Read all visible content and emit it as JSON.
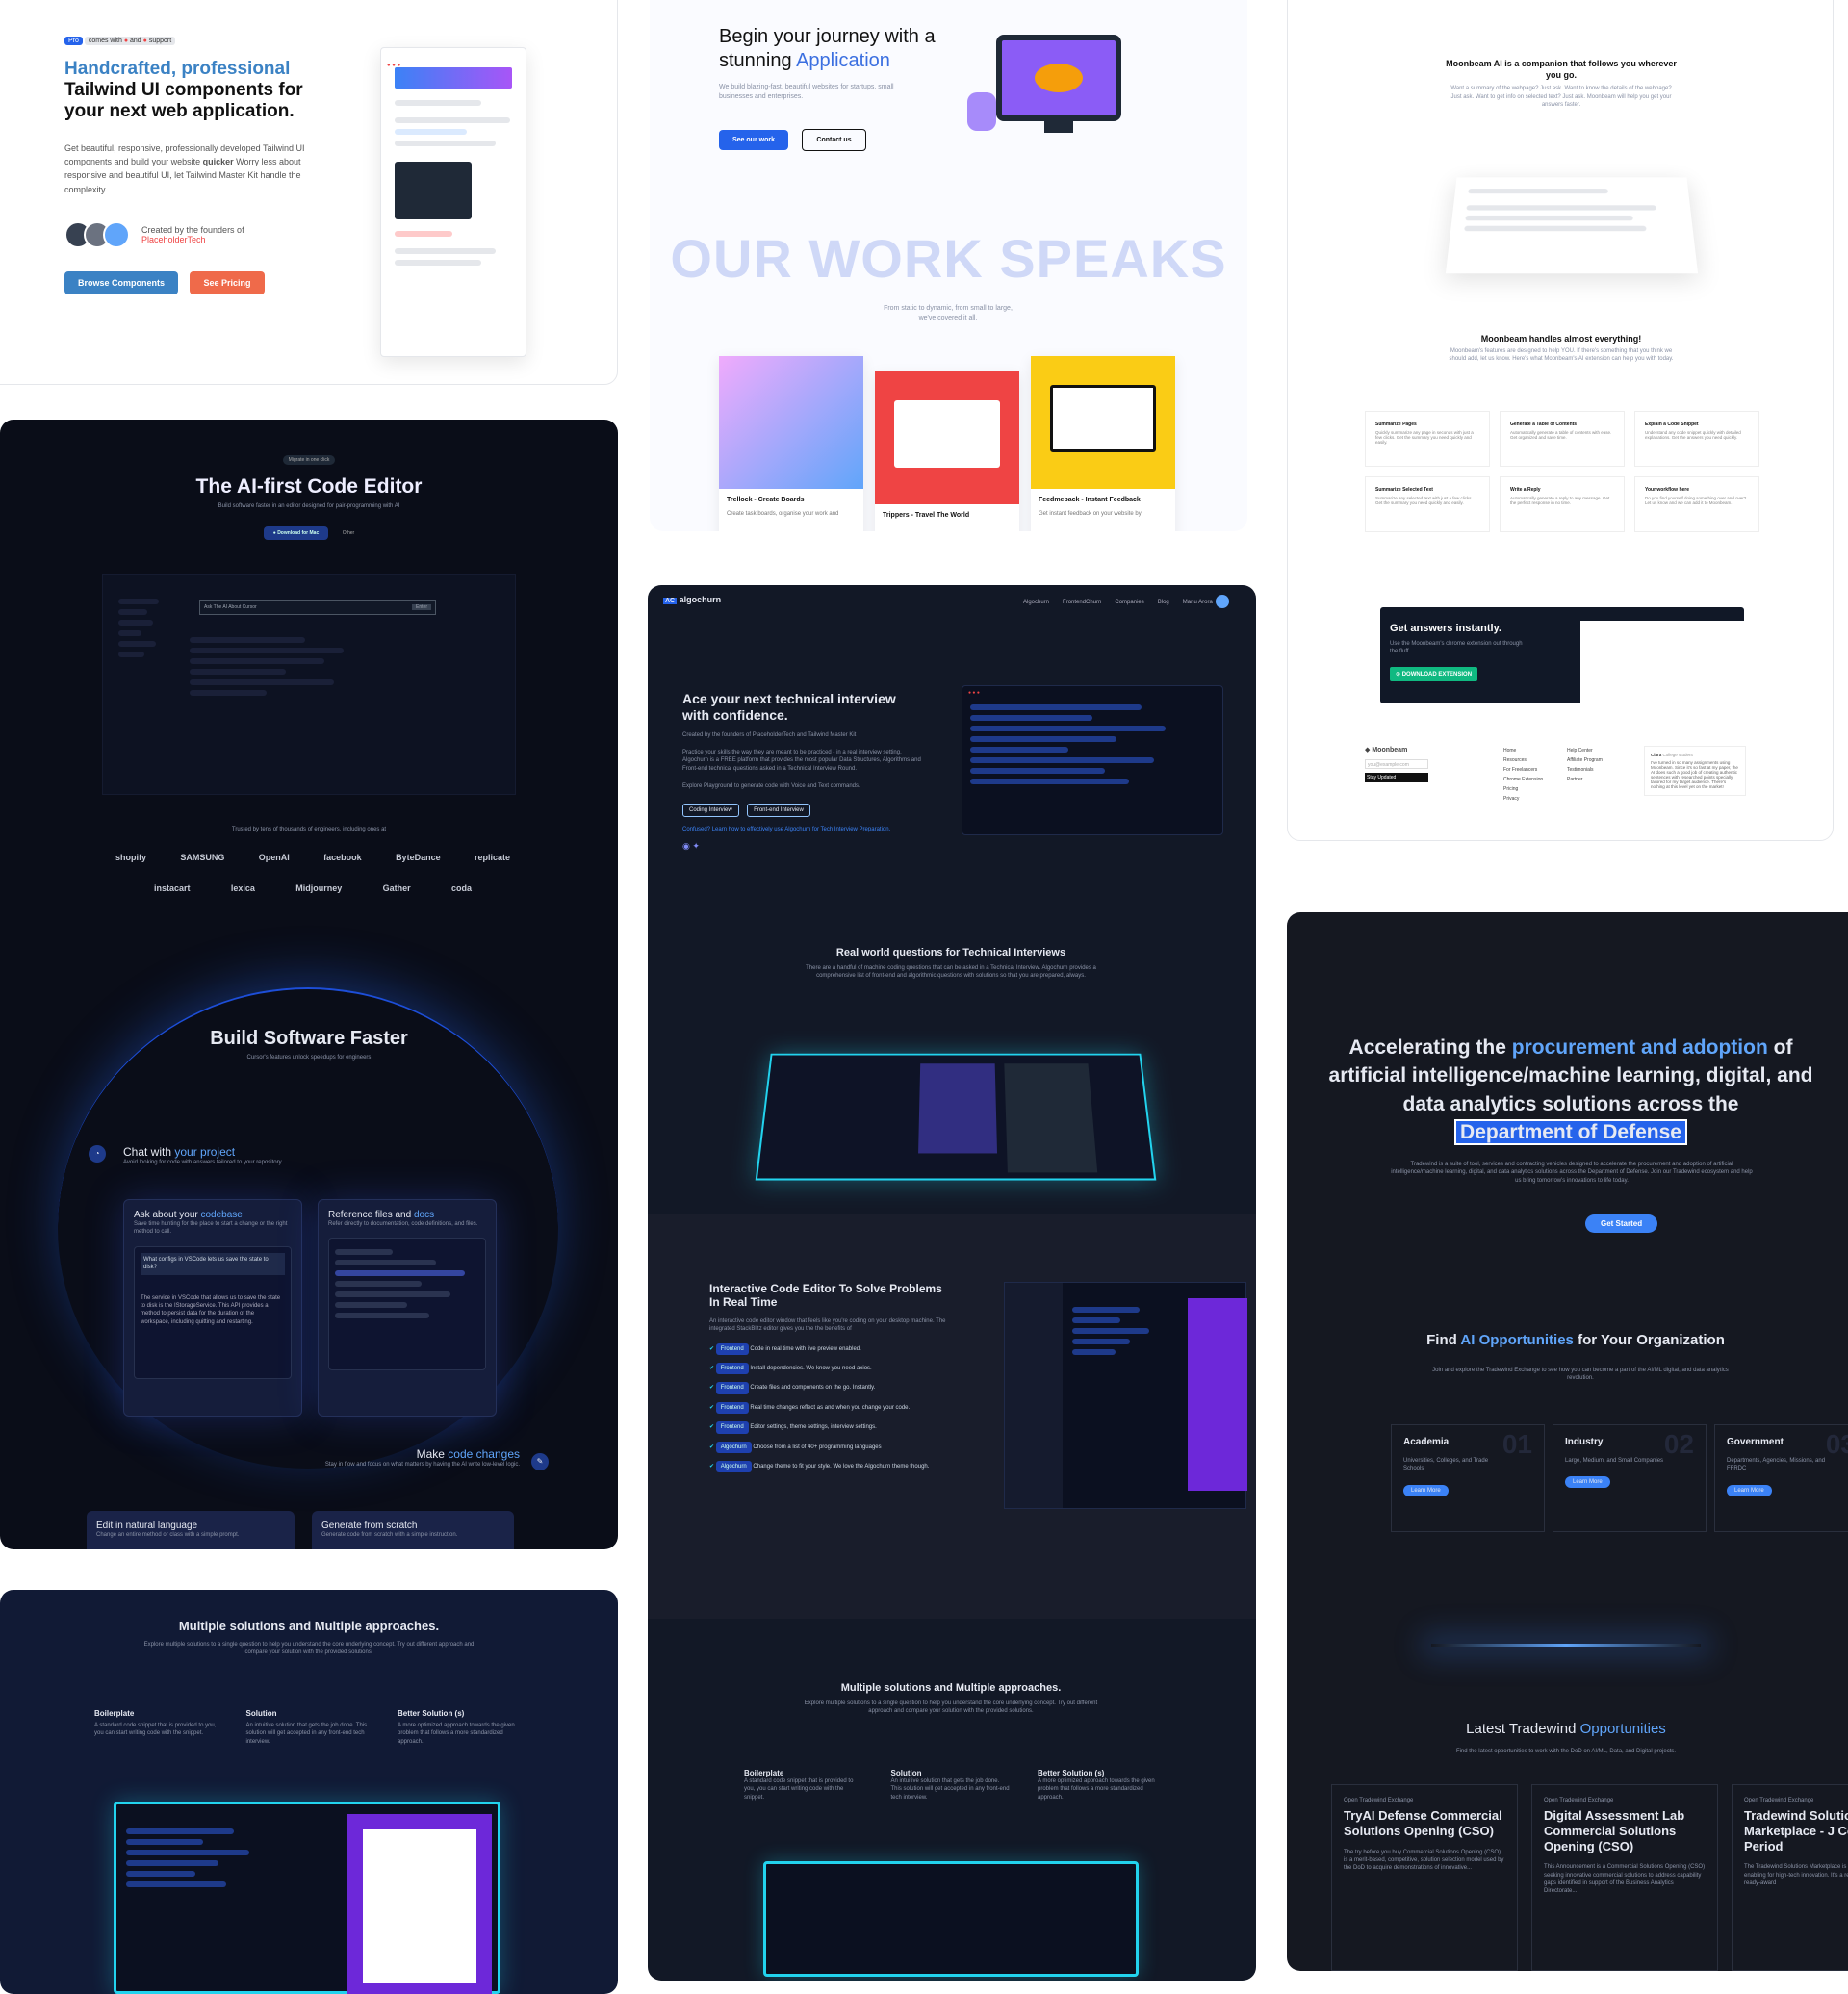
{
  "c1": {
    "badge_pro": "Pro",
    "badge_comes": "comes with",
    "badge_and": "and",
    "badge_support": "support",
    "title_hl": "Handcrafted, professional",
    "title_rest": "Tailwind UI components for your next web application.",
    "desc1": "Get beautiful, responsive, professionally developed Tailwind UI components and build your website",
    "desc_bold": "quicker",
    "desc2": "Worry less about responsive and beautiful UI, let Tailwind Master Kit handle the complexity.",
    "created_by": "Created by the founders of",
    "created_link": "PlaceholderTech",
    "btn_browse": "Browse Components",
    "btn_pricing": "See Pricing"
  },
  "c2": {
    "title_a": "Begin your journey with a",
    "title_b": "stunning",
    "title_hl": "Application",
    "desc": "We build blazing-fast, beautiful websites for startups, small businesses and enterprises.",
    "btn_work": "See our work",
    "btn_contact": "Contact us",
    "big": "OUR WORK SPEAKS",
    "sub": "From static to dynamic, from small to large, we've covered it all.",
    "projects": [
      {
        "title": "Trellock - Create Boards",
        "desc": "Create task boards, organise your work and"
      },
      {
        "title": "Trippers - Travel The World",
        "desc": ""
      },
      {
        "title": "Feedmeback - Instant Feedback",
        "desc": "Get instant feedback on your website by"
      }
    ]
  },
  "c3": {
    "intro_title": "Moonbeam AI is a companion that follows you wherever you go.",
    "intro_desc": "Want a summary of the webpage? Just ask. Want to know the details of the webpage? Just ask. Want to get info on selected text? Just ask. Moonbeam will help you get your answers faster.",
    "handles_title": "Moonbeam handles almost everything!",
    "handles_desc": "Moonbeam's features are designed to help YOU. If there's something that you think we should add, let us know. Here's what Moonbeam's AI extension can help you with today.",
    "features": [
      {
        "t": "Summarize Pages",
        "d": "Quickly summarize any page in seconds with just a few clicks. Get the summary you need quickly and easily."
      },
      {
        "t": "Generate a Table of Contents",
        "d": "Automatically generate a table of contents with ease. Get organized and save time."
      },
      {
        "t": "Explain a Code Snippet",
        "d": "Understand any code snippet quickly with detailed explanations. Get the answers you need quickly."
      },
      {
        "t": "Summarize Selected Text",
        "d": "Summarize any selected text with just a few clicks. Get the summary you need quickly and easily."
      },
      {
        "t": "Write a Reply",
        "d": "Automatically generate a reply to any message. Get the perfect response in no time."
      },
      {
        "t": "Your workflow here",
        "d": "Do you find yourself doing something over and over? Let us know and we can add it to Moonbeam."
      }
    ],
    "cta_title": "Get answers instantly.",
    "cta_desc": "Use the Moonbeam's chrome extension out through the fluff.",
    "cta_btn": "DOWNLOAD EXTENSION",
    "footer_brand": "Moonbeam",
    "footer_input": "you@example.com",
    "footer_btn": "Stay Updated",
    "footer_col1": [
      "Home",
      "Resources",
      "For Freelancers",
      "Chrome Extension",
      "Pricing",
      "Privacy"
    ],
    "footer_col2": [
      "Help Center",
      "Affiliate Program",
      "Testimonials",
      "Partner"
    ],
    "testimonial_name": "Clara",
    "testimonial_role": "College student",
    "testimonial": "I've turned in so many assignments using Moonbeam. Since it's so fast at my paper, the AI does such a good job of creating authentic sentences with researched points specially tailored for my target audience. There's nothing at this level yet on the market!"
  },
  "c4": {
    "badge": "Migrate in one click",
    "title": "The AI-first Code Editor",
    "sub": "Build software faster in an editor designed for pair-programming with AI",
    "btn_download": "Download for Mac",
    "btn_other": "Other",
    "ask_placeholder": "Ask The AI About Cursor",
    "ask_btn": "Enter",
    "trusted": "Trusted by tens of thousands of engineers, including ones at",
    "logos": [
      "shopify",
      "SAMSUNG",
      "OpenAI",
      "facebook",
      "ByteDance",
      "replicate",
      "instacart",
      "lexica",
      "Midjourney",
      "Gather",
      "coda"
    ],
    "build_title": "Build Software Faster",
    "build_sub": "Cursor's features unlock speedups for engineers",
    "chat_title": "Chat with",
    "chat_hl": "your project",
    "chat_desc": "Avoid looking for code with answers tailored to your repository.",
    "panel1_title": "Ask about your",
    "panel1_hl": "codebase",
    "panel1_desc": "Save time hunting for the place to start a change or the right method to call.",
    "panel1_q": "What configs in VSCode lets us save the state to disk?",
    "panel1_a": "The service in VSCode that allows us to save the state to disk is the IStorageService. This API provides a method to persist data for the duration of the workspace, including quitting and restarting.",
    "panel2_title": "Reference files and",
    "panel2_hl": "docs",
    "panel2_desc": "Refer directly to documentation, code definitions, and files.",
    "make_title": "Make",
    "make_hl": "code changes",
    "make_desc": "Stay in flow and focus on what matters by having the AI write low-level logic.",
    "edit_title": "Edit in natural language",
    "edit_desc": "Change an entire method or class with a simple prompt.",
    "gen_title": "Generate from scratch",
    "gen_desc": "Generate code from scratch with a simple instruction."
  },
  "c5": {
    "brand": "algochurn",
    "nav": [
      "Algochurn",
      "FrontendChurn",
      "Companies",
      "Blog",
      "Manu Arora"
    ],
    "hero_title": "Ace your next technical interview with confidence.",
    "hero_created": "Created by the founders of PlaceholderTech and Tailwind Master Kit",
    "hero_desc": "Practice your skills the way they are meant to be practiced - in a real interview setting. Algochurn is a FREE platform that provides the most popular Data Structures, Algorithms and Front-end technical questions asked in a Technical Interview Round.",
    "hero_explore": "Explore Playground to generate code with Voice and Text commands.",
    "btn_coding": "Coding Interview",
    "btn_frontend": "Front-end Interview",
    "confused": "Confused? Learn how to effectively use Algochurn for Tech Interview Preparation.",
    "real_title": "Real world questions for Technical Interviews",
    "real_desc": "There are a handful of machine coding questions that can be asked in a Technical Interview. Algochurn provides a comprehensive list of front-end and algorithmic questions with solutions so that you are prepared, always.",
    "editor_title": "Interactive Code Editor To Solve Problems In Real Time",
    "editor_desc": "An interactive code editor window that feels like you're coding on your desktop machine. The integrated StackBlitz editor gives you the the benefits of",
    "features": [
      {
        "tag": "Frontend",
        "text": "Code in real time with live preview enabled."
      },
      {
        "tag": "Frontend",
        "text": "Install dependencies. We know you need axios."
      },
      {
        "tag": "Frontend",
        "text": "Create files and components on the go. Instantly."
      },
      {
        "tag": "Frontend",
        "text": "Real time changes reflect as and when you change your code."
      },
      {
        "tag": "Frontend",
        "text": "Editor settings, theme settings, interview settings."
      },
      {
        "tag": "Algochurn",
        "text": "Choose from a list of 40+ programming languages"
      },
      {
        "tag": "Algochurn",
        "text": "Change theme to fit your style. We love the Algochurn theme though."
      }
    ],
    "multi_title": "Multiple solutions and Multiple approaches.",
    "multi_desc": "Explore multiple solutions to a single question to help you understand the core underlying concept. Try out different approach and compare your solution with the provided solutions.",
    "cols": [
      {
        "t": "Boilerplate",
        "d": "A standard code snippet that is provided to you, you can start writing code with the snippet."
      },
      {
        "t": "Solution",
        "d": "An intuitive solution that gets the job done. This solution will get accepted in any front-end tech interview."
      },
      {
        "t": "Better Solution (s)",
        "d": "A more optimized approach towards the given problem that follows a more standardized approach."
      }
    ]
  },
  "c6": {
    "title": "Multiple solutions and Multiple approaches.",
    "desc": "Explore multiple solutions to a single question to help you understand the core underlying concept. Try out different approach and compare your solution with the provided solutions.",
    "cols": [
      {
        "t": "Boilerplate",
        "d": "A standard code snippet that is provided to you, you can start writing code with the snippet."
      },
      {
        "t": "Solution",
        "d": "An intuitive solution that gets the job done. This solution will get accepted in any front-end tech interview."
      },
      {
        "t": "Better Solution (s)",
        "d": "A more optimized approach towards the given problem that follows a more standardized approach."
      }
    ]
  },
  "c7": {
    "hero_a": "Accelerating the",
    "hero_hl": "procurement and adoption",
    "hero_b": "of artificial intelligence/machine learning, digital, and data analytics solutions across the",
    "hero_box": "Department of Defense",
    "hero_desc": "Tradewind is a suite of tool, services and contracting vehicles designed to accelerate the procurement and adoption of artificial intelligence/machine learning, digital, and data analytics solutions across the Department of Defense. Join our Tradewind ecosystem and help us bring tomorrow's innovations to life today.",
    "btn_start": "Get Started",
    "find_a": "Find",
    "find_hl": "AI Opportunities",
    "find_b": "for Your Organization",
    "find_desc": "Join and explore the Tradewind Exchange to see how you can become a part of the AI/ML digital, and data analytics revolution.",
    "orgs": [
      {
        "num": "01",
        "t": "Academia",
        "d": "Universities, Colleges, and Trade Schools",
        "b": "Learn More"
      },
      {
        "num": "02",
        "t": "Industry",
        "d": "Large, Medium, and Small Companies",
        "b": "Learn More"
      },
      {
        "num": "03",
        "t": "Government",
        "d": "Departments, Agencies, Missions, and FFRDC",
        "b": "Learn More"
      }
    ],
    "latest_a": "Latest Tradewind",
    "latest_hl": "Opportunities",
    "latest_desc": "Find the latest opportunities to work with the DoD on AI/ML, Data, and Digital projects.",
    "opps": [
      {
        "status": "Open",
        "src": "Tradewind Exchange",
        "t": "TryAI Defense Commercial Solutions Opening (CSO)",
        "d": "The try before you buy Commercial Solutions Opening (CSO) is a merit-based, competitive, solution selection model used by the DoD to acquire demonstrations of innovative..."
      },
      {
        "status": "Open",
        "src": "Tradewind Exchange",
        "t": "Digital Assessment Lab Commercial Solutions Opening (CSO)",
        "d": "This Announcement is a Commercial Solutions Opening (CSO) seeking innovative commercial solutions to address capability gaps identified in support of the Business Analytics Directorate..."
      },
      {
        "status": "Open",
        "src": "Tradewind Exchange",
        "t": "Tradewind Solutions Marketplace - J Collection Period",
        "d": "The Tradewind Solutions Marketplace is the DoD's ground-breaking enabling for high-tech innovation. It's a result of post-competition, ready-award"
      }
    ]
  }
}
